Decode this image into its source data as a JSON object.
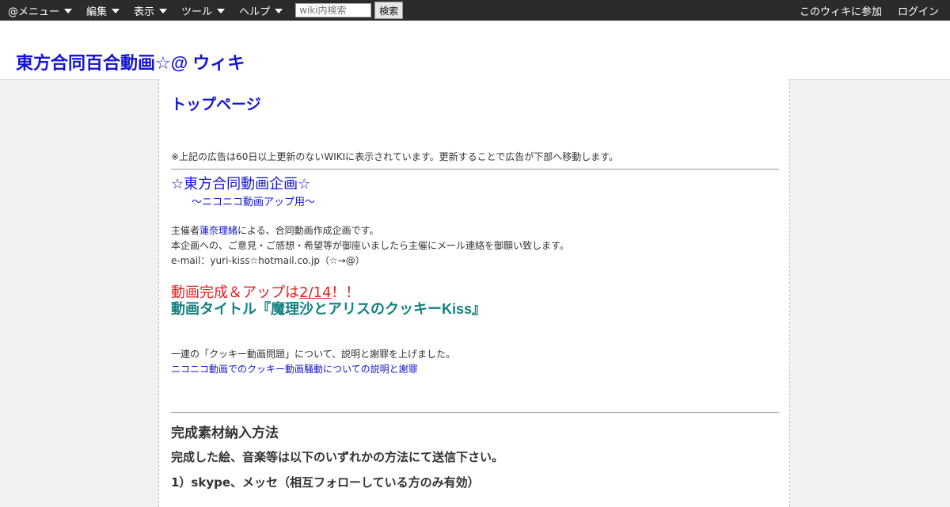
{
  "topbar": {
    "menus": [
      {
        "label": "@メニュー"
      },
      {
        "label": "編集"
      },
      {
        "label": "表示"
      },
      {
        "label": "ツール"
      },
      {
        "label": "ヘルプ"
      }
    ],
    "search": {
      "placeholder": "wiki内検索",
      "value": "",
      "button_label": "検索"
    },
    "right_links": {
      "join": "このウィキに参加",
      "login": "ログイン"
    }
  },
  "header": {
    "site_title": "東方合同百合動画☆@ ウィキ"
  },
  "main": {
    "page_title": "トップページ",
    "ad_note": "※上記の広告は60日以上更新のないWIKIに表示されています。更新することで広告が下部へ移動します。",
    "project_title": "☆東方合同動画企画☆",
    "project_subtitle": "～ニコニコ動画アップ用～",
    "intro": {
      "prefix": "主催者",
      "organizer_link": "蓮奈理緒",
      "suffix": "による、合同動画作成企画です。",
      "contact_line": "本企画への、ご意見・ご感想・希望等が御座いましたら主催にメール連絡を御願い致します。",
      "email_line": "e-mail：yuri-kiss☆hotmail.co.jp（☆→@）"
    },
    "release": {
      "prefix": "動画完成＆アップは",
      "date": "2/14",
      "suffix": "！！"
    },
    "movie_title": "動画タイトル『魔理沙とアリスのクッキーKiss』",
    "apology": {
      "text": "一連の「クッキー動画問題」について、説明と謝罪を上げました。",
      "link": "ニコニコ動画でのクッキー動画騒動についての説明と謝罪"
    },
    "submission": {
      "heading": "完成素材納入方法",
      "instruction": "完成した絵、音楽等は以下のいずれかの方法にて送信下さい。",
      "method1": "1）skype、メッセ（相互フォローしている方のみ有効）"
    }
  },
  "colors": {
    "link": "#1515d0",
    "release_red": "#e02020",
    "movie_teal": "#138080",
    "topbar": "#2b2b2b"
  }
}
